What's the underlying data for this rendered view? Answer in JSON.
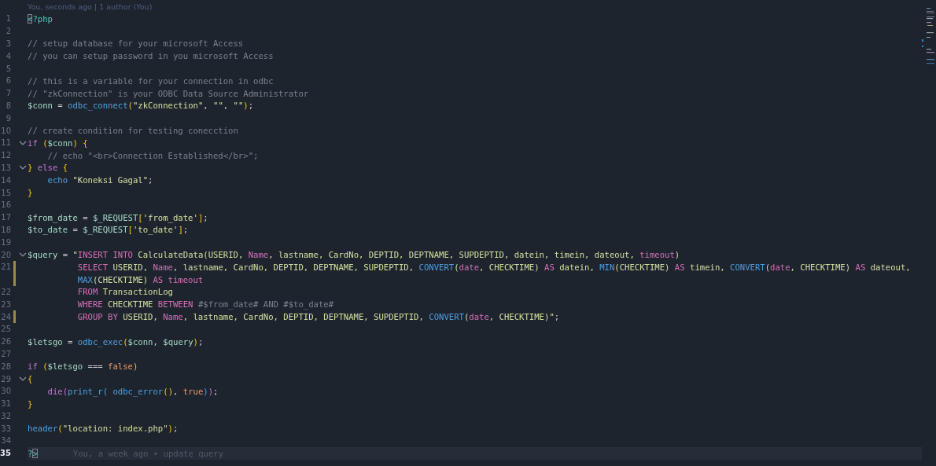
{
  "blame_header": "You, seconds ago | 1 author (You)",
  "lines": [
    {
      "number": "1",
      "fold": false,
      "modified": false,
      "current": false,
      "tokens": [
        {
          "text": "<",
          "kind": "matched"
        },
        {
          "text": "?php",
          "kind": "tag"
        }
      ]
    },
    {
      "number": "2",
      "fold": false,
      "modified": false,
      "current": false
    },
    {
      "number": "3",
      "fold": false,
      "modified": false,
      "current": false,
      "tokens": [
        {
          "text": "// setup database for your microsoft Access",
          "kind": "comment"
        }
      ]
    },
    {
      "number": "4",
      "fold": false,
      "modified": false,
      "current": false,
      "tokens": [
        {
          "text": "// you can setup password in you microsoft Access",
          "kind": "comment"
        }
      ]
    },
    {
      "number": "5",
      "fold": false,
      "modified": false,
      "current": false
    },
    {
      "number": "6",
      "fold": false,
      "modified": false,
      "current": false,
      "tokens": [
        {
          "text": "// this is a variable for your connection in odbc",
          "kind": "comment"
        }
      ]
    },
    {
      "number": "7",
      "fold": false,
      "modified": false,
      "current": false,
      "tokens": [
        {
          "text": "// \"zkConnection\" is your ODBC Data Source Administrator",
          "kind": "comment"
        }
      ]
    },
    {
      "number": "8",
      "fold": false,
      "modified": false,
      "current": false,
      "tokens": [
        {
          "text": "$conn",
          "kind": "var"
        },
        {
          "text": " = ",
          "kind": "plain"
        },
        {
          "text": "odbc_connect",
          "kind": "func"
        },
        {
          "text": "(",
          "kind": "b1"
        },
        {
          "text": "\"zkConnection\"",
          "kind": "string"
        },
        {
          "text": ", ",
          "kind": "plain"
        },
        {
          "text": "\"\"",
          "kind": "string"
        },
        {
          "text": ", ",
          "kind": "plain"
        },
        {
          "text": "\"\"",
          "kind": "string"
        },
        {
          "text": ")",
          "kind": "b1"
        },
        {
          "text": ";",
          "kind": "plain"
        }
      ]
    },
    {
      "number": "9",
      "fold": false,
      "modified": false,
      "current": false
    },
    {
      "number": "10",
      "fold": false,
      "modified": false,
      "current": false,
      "tokens": [
        {
          "text": "// create condition for testing conecction",
          "kind": "comment"
        }
      ]
    },
    {
      "number": "11",
      "fold": true,
      "modified": false,
      "current": false,
      "tokens": [
        {
          "text": "if",
          "kind": "keyword"
        },
        {
          "text": " (",
          "kind": "b1"
        },
        {
          "text": "$conn",
          "kind": "var"
        },
        {
          "text": ")",
          "kind": "b1"
        },
        {
          "text": " {",
          "kind": "b1"
        }
      ]
    },
    {
      "number": "12",
      "fold": false,
      "modified": false,
      "current": false,
      "tokens": [
        {
          "text": "    // echo \"<br>Connection Established</br>\";",
          "kind": "comment"
        }
      ]
    },
    {
      "number": "13",
      "fold": true,
      "modified": false,
      "current": false,
      "tokens": [
        {
          "text": "}",
          "kind": "b1"
        },
        {
          "text": " else",
          "kind": "keyword"
        },
        {
          "text": " {",
          "kind": "b1"
        }
      ]
    },
    {
      "number": "14",
      "fold": false,
      "modified": false,
      "current": false,
      "tokens": [
        {
          "text": "    echo",
          "kind": "func"
        },
        {
          "text": " \"Koneksi Gagal\"",
          "kind": "string"
        },
        {
          "text": ";",
          "kind": "plain"
        }
      ]
    },
    {
      "number": "15",
      "fold": false,
      "modified": false,
      "current": false,
      "tokens": [
        {
          "text": "}",
          "kind": "b1"
        }
      ]
    },
    {
      "number": "16",
      "fold": false,
      "modified": false,
      "current": false
    },
    {
      "number": "17",
      "fold": false,
      "modified": false,
      "current": false,
      "tokens": [
        {
          "text": "$from_date",
          "kind": "var"
        },
        {
          "text": " = ",
          "kind": "plain"
        },
        {
          "text": "$_REQUEST",
          "kind": "var"
        },
        {
          "text": "[",
          "kind": "b1"
        },
        {
          "text": "'from_date'",
          "kind": "string"
        },
        {
          "text": "]",
          "kind": "b1"
        },
        {
          "text": ";",
          "kind": "plain"
        }
      ]
    },
    {
      "number": "18",
      "fold": false,
      "modified": false,
      "current": false,
      "tokens": [
        {
          "text": "$to_date",
          "kind": "var"
        },
        {
          "text": " = ",
          "kind": "plain"
        },
        {
          "text": "$_REQUEST",
          "kind": "var"
        },
        {
          "text": "[",
          "kind": "b1"
        },
        {
          "text": "'to_date'",
          "kind": "string"
        },
        {
          "text": "]",
          "kind": "b1"
        },
        {
          "text": ";",
          "kind": "plain"
        }
      ]
    },
    {
      "number": "19",
      "fold": false,
      "modified": false,
      "current": false
    },
    {
      "number": "20",
      "fold": true,
      "modified": false,
      "current": false,
      "tokens": [
        {
          "text": "$query",
          "kind": "var"
        },
        {
          "text": " = ",
          "kind": "plain"
        },
        {
          "text": "\"",
          "kind": "string"
        },
        {
          "text": "INSERT INTO",
          "kind": "sqlkw"
        },
        {
          "text": " CalculateData(USERID, ",
          "kind": "sql"
        },
        {
          "text": "Name",
          "kind": "sqlkw"
        },
        {
          "text": ", lastname, CardNo, DEPTID, DEPTNAME, SUPDEPTID, datein, timein, dateout, ",
          "kind": "sql"
        },
        {
          "text": "timeout",
          "kind": "sqlkw"
        },
        {
          "text": ")",
          "kind": "sql"
        }
      ]
    },
    {
      "number": "21",
      "fold": false,
      "modified": true,
      "current": false,
      "tokens": [
        {
          "text": "          SELECT",
          "kind": "sqlkw"
        },
        {
          "text": " USERID, ",
          "kind": "sql"
        },
        {
          "text": "Name",
          "kind": "sqlkw"
        },
        {
          "text": ", lastname, CardNo, DEPTID, DEPTNAME, SUPDEPTID, ",
          "kind": "sql"
        },
        {
          "text": "CONVERT",
          "kind": "sqlfn"
        },
        {
          "text": "(",
          "kind": "sql"
        },
        {
          "text": "date",
          "kind": "sqlkw"
        },
        {
          "text": ", CHECKTIME) ",
          "kind": "sql"
        },
        {
          "text": "AS",
          "kind": "sqlkw"
        },
        {
          "text": " datein, ",
          "kind": "sql"
        },
        {
          "text": "MIN",
          "kind": "sqlfn"
        },
        {
          "text": "(CHECKTIME) ",
          "kind": "sql"
        },
        {
          "text": "AS",
          "kind": "sqlkw"
        },
        {
          "text": " timein, ",
          "kind": "sql"
        },
        {
          "text": "CONVERT",
          "kind": "sqlfn"
        },
        {
          "text": "(",
          "kind": "sql"
        },
        {
          "text": "date",
          "kind": "sqlkw"
        },
        {
          "text": ", CHECKTIME) ",
          "kind": "sql"
        },
        {
          "text": "AS",
          "kind": "sqlkw"
        },
        {
          "text": " dateout,",
          "kind": "sql"
        }
      ],
      "wrap": [
        {
          "text": "          MAX",
          "kind": "sqlfn"
        },
        {
          "text": "(CHECKTIME) ",
          "kind": "sql"
        },
        {
          "text": "AS timeout",
          "kind": "sqlkw"
        }
      ]
    },
    {
      "number": "22",
      "fold": false,
      "modified": false,
      "current": false,
      "tokens": [
        {
          "text": "          FROM",
          "kind": "sqlkw"
        },
        {
          "text": " TransactionLog",
          "kind": "sql"
        }
      ]
    },
    {
      "number": "23",
      "fold": false,
      "modified": false,
      "current": false,
      "tokens": [
        {
          "text": "          WHERE",
          "kind": "sqlkw"
        },
        {
          "text": " CHECKTIME ",
          "kind": "sql"
        },
        {
          "text": "BETWEEN",
          "kind": "sqlkw"
        },
        {
          "text": " #$from_date# AND #$to_date#",
          "kind": "comment"
        }
      ]
    },
    {
      "number": "24",
      "fold": false,
      "modified": true,
      "current": false,
      "tokens": [
        {
          "text": "          GROUP BY",
          "kind": "sqlkw"
        },
        {
          "text": " USERID, ",
          "kind": "sql"
        },
        {
          "text": "Name",
          "kind": "sqlkw"
        },
        {
          "text": ", lastname, CardNo, DEPTID, DEPTNAME, SUPDEPTID, ",
          "kind": "sql"
        },
        {
          "text": "CONVERT",
          "kind": "sqlfn"
        },
        {
          "text": "(",
          "kind": "sql"
        },
        {
          "text": "date",
          "kind": "sqlkw"
        },
        {
          "text": ", CHECKTIME)",
          "kind": "sql"
        },
        {
          "text": "\"",
          "kind": "string"
        },
        {
          "text": ";",
          "kind": "plain"
        }
      ]
    },
    {
      "number": "25",
      "fold": false,
      "modified": false,
      "current": false
    },
    {
      "number": "26",
      "fold": false,
      "modified": false,
      "current": false,
      "tokens": [
        {
          "text": "$letsgo",
          "kind": "var"
        },
        {
          "text": " = ",
          "kind": "plain"
        },
        {
          "text": "odbc_exec",
          "kind": "func"
        },
        {
          "text": "(",
          "kind": "b1"
        },
        {
          "text": "$conn",
          "kind": "var"
        },
        {
          "text": ", ",
          "kind": "plain"
        },
        {
          "text": "$query",
          "kind": "var"
        },
        {
          "text": ")",
          "kind": "b1"
        },
        {
          "text": ";",
          "kind": "plain"
        }
      ]
    },
    {
      "number": "27",
      "fold": false,
      "modified": false,
      "current": false
    },
    {
      "number": "28",
      "fold": false,
      "modified": false,
      "current": false,
      "tokens": [
        {
          "text": "if",
          "kind": "keyword"
        },
        {
          "text": " (",
          "kind": "b1"
        },
        {
          "text": "$letsgo",
          "kind": "var"
        },
        {
          "text": " === ",
          "kind": "plain"
        },
        {
          "text": "false",
          "kind": "const"
        },
        {
          "text": ")",
          "kind": "b1"
        }
      ]
    },
    {
      "number": "29",
      "fold": true,
      "modified": false,
      "current": false,
      "tokens": [
        {
          "text": "{",
          "kind": "b1"
        }
      ]
    },
    {
      "number": "30",
      "fold": false,
      "modified": false,
      "current": false,
      "tokens": [
        {
          "text": "    die",
          "kind": "keyword"
        },
        {
          "text": "(",
          "kind": "b2"
        },
        {
          "text": "print_r",
          "kind": "func"
        },
        {
          "text": "(",
          "kind": "b3"
        },
        {
          "text": " odbc_error",
          "kind": "func"
        },
        {
          "text": "()",
          "kind": "b1"
        },
        {
          "text": ", ",
          "kind": "plain"
        },
        {
          "text": "true",
          "kind": "const"
        },
        {
          "text": ")",
          "kind": "b3"
        },
        {
          "text": ")",
          "kind": "b2"
        },
        {
          "text": ";",
          "kind": "plain"
        }
      ]
    },
    {
      "number": "31",
      "fold": false,
      "modified": false,
      "current": false,
      "tokens": [
        {
          "text": "}",
          "kind": "b1"
        }
      ]
    },
    {
      "number": "32",
      "fold": false,
      "modified": false,
      "current": false
    },
    {
      "number": "33",
      "fold": false,
      "modified": false,
      "current": false,
      "tokens": [
        {
          "text": "header",
          "kind": "func"
        },
        {
          "text": "(",
          "kind": "b1"
        },
        {
          "text": "\"location: index.php\"",
          "kind": "string"
        },
        {
          "text": ")",
          "kind": "b1"
        },
        {
          "text": ";",
          "kind": "plain"
        }
      ]
    },
    {
      "number": "34",
      "fold": false,
      "modified": false,
      "current": false
    },
    {
      "number": "35",
      "fold": false,
      "modified": false,
      "current": true,
      "tokens": [
        {
          "text": "?",
          "kind": "tag"
        },
        {
          "text": ">",
          "kind": "matched"
        }
      ],
      "blame": "You, a week ago • update query"
    }
  ]
}
